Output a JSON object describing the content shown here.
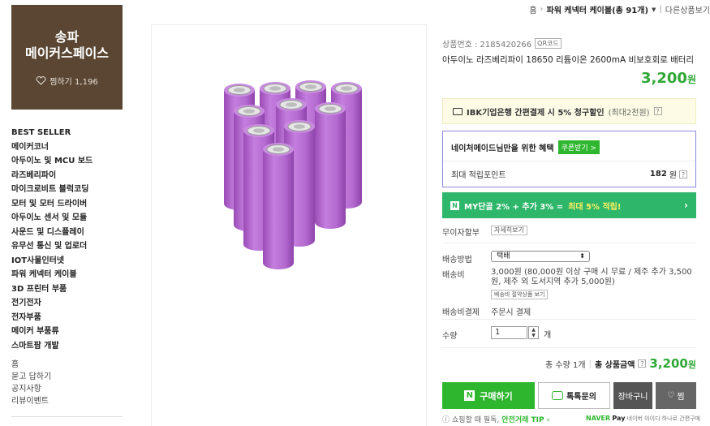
{
  "breadcrumb": {
    "home": "홈",
    "category": "파워 케넥터 케이블(총 91개)",
    "other": "다른상품보기"
  },
  "store": {
    "name_line1": "송파",
    "name_line2": "메이커스페이스",
    "fav_label": "찜하기 1,196"
  },
  "nav": {
    "items": [
      "BEST SELLER",
      "메이커코너",
      "아두이노 및 MCU 보드",
      "라즈베리파이",
      "마이크로비트 블럭코딩",
      "모터 및 모터 드라이버",
      "아두이노 센서 및 모듈",
      "사운드 및 디스플레이",
      "유무선 통신 및 업로더",
      "IOT사물인터넷",
      "파워 케넥터 케이블",
      "3D 프린터 부품",
      "전기전자",
      "전자부품",
      "메이커 부품류",
      "스마트팜 개발"
    ],
    "sub": [
      "홈",
      "묻고 답하기",
      "공지사항",
      "리뷰이벤트"
    ]
  },
  "product": {
    "number_label": "상품번호 : 2185420266",
    "qr_label": "QR코드",
    "title": "아두이노 라즈베리파이 18650 리튬이온 2600mA 비보호회로 배터리",
    "price": "3,200",
    "won": "원"
  },
  "ibk": {
    "text_bold": "IBK기업은행 간편결제 시 5% 청구할인",
    "text_grey": "(최대2천원)",
    "q": "?"
  },
  "benefit": {
    "head": "네이처메이드님만을 위한 혜택",
    "coupon": "쿠폰받기 >",
    "points_label": "최대 적립포인트",
    "points_value": "182",
    "points_unit": "원",
    "q": "?"
  },
  "mybar": {
    "badge": "N",
    "text": "MY단골 2% + 추가 3% =",
    "highlight": "최대 5% 적립!",
    "arrow": "›"
  },
  "rows": {
    "interest_free_label": "무이자할부",
    "interest_free_btn": "자세히보기",
    "ship_method_label": "배송방법",
    "ship_method_value": "택배",
    "ship_fee_label": "배송비",
    "ship_fee_text": "3,000원 (80,000원 이상 구매 시 무료 / 제주 추가 3,500원, 제주 외 도서지역 추가 5,000원)",
    "ship_fee_btn": "배송비 절약상품 보기",
    "ship_pay_label": "배송비결제",
    "ship_pay_value": "주문시 결제",
    "qty_label": "수량",
    "qty_value": "1",
    "qty_unit": "개"
  },
  "total": {
    "count": "총 수량 1개",
    "label": "총 상품금액",
    "q": "?",
    "amount": "3,200",
    "won": "원"
  },
  "buttons": {
    "buy_badge": "N",
    "buy": "구매하기",
    "talk": "톡톡문의",
    "cart": "장바구니",
    "zzim": "찜"
  },
  "footer": {
    "safe_pre": "쇼핑할 때 필독,",
    "safe_link": "안전거래 TIP ›",
    "npay_brand": "NAVER",
    "npay_pay": "Pay",
    "npay_text": "네이버 아이디 하나로 간편구매"
  },
  "colors": {
    "accent_green": "#2eb72e",
    "price_green": "#2fa836",
    "store_brown": "#5a4632",
    "battery_purple": "#b46ad0"
  }
}
